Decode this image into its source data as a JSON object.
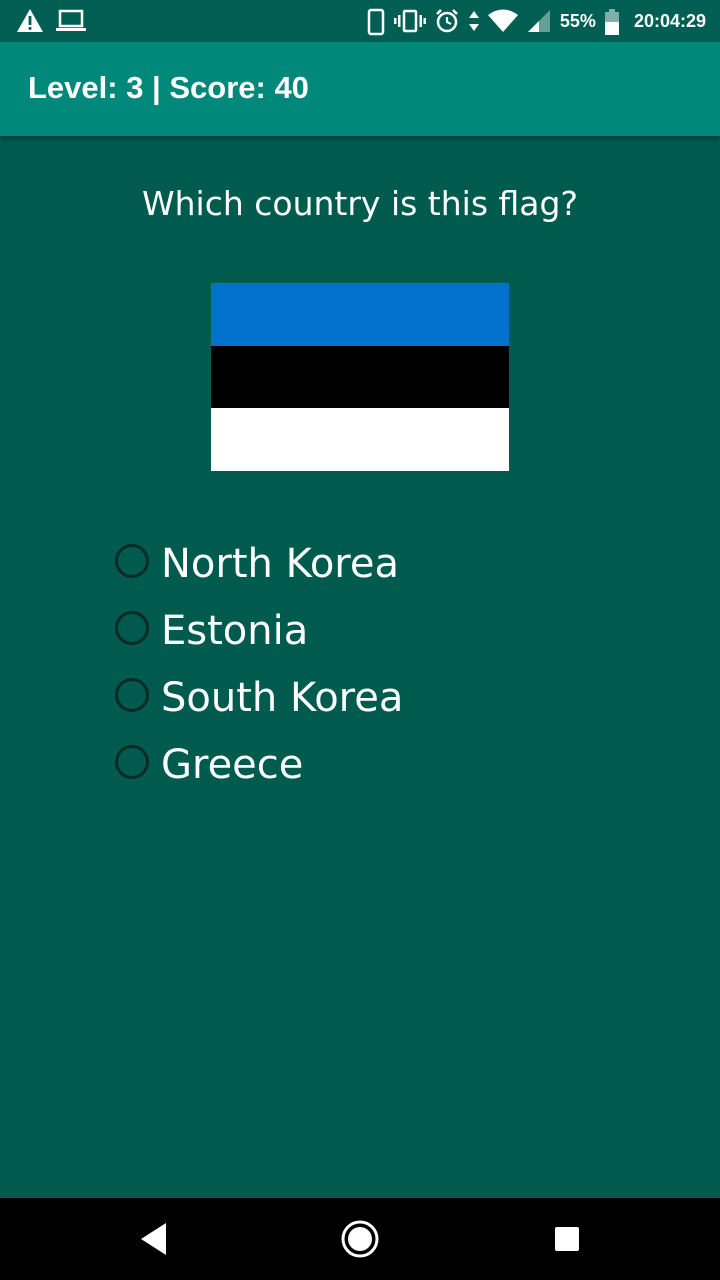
{
  "status_bar": {
    "battery_percent": "55%",
    "time": "20:04:29",
    "icons": [
      "warning-icon",
      "laptop-icon",
      "phone-icon",
      "vibrate-icon",
      "alarm-icon",
      "data-arrows-icon",
      "wifi-icon",
      "cell-signal-icon",
      "battery-icon"
    ]
  },
  "app_bar": {
    "title": "Level: 3 | Score: 40",
    "color": "#00897B"
  },
  "quiz": {
    "question": "Which country is this flag?",
    "flag_colors": [
      "#0072CE",
      "#000000",
      "#FFFFFF"
    ],
    "options": [
      "North Korea",
      "Estonia",
      "South Korea",
      "Greece"
    ],
    "selected": null
  },
  "nav_bar": {
    "icons": [
      "back-icon",
      "home-icon",
      "recents-icon"
    ]
  },
  "colors": {
    "background": "#005B4F",
    "status_bar": "#005F52"
  }
}
